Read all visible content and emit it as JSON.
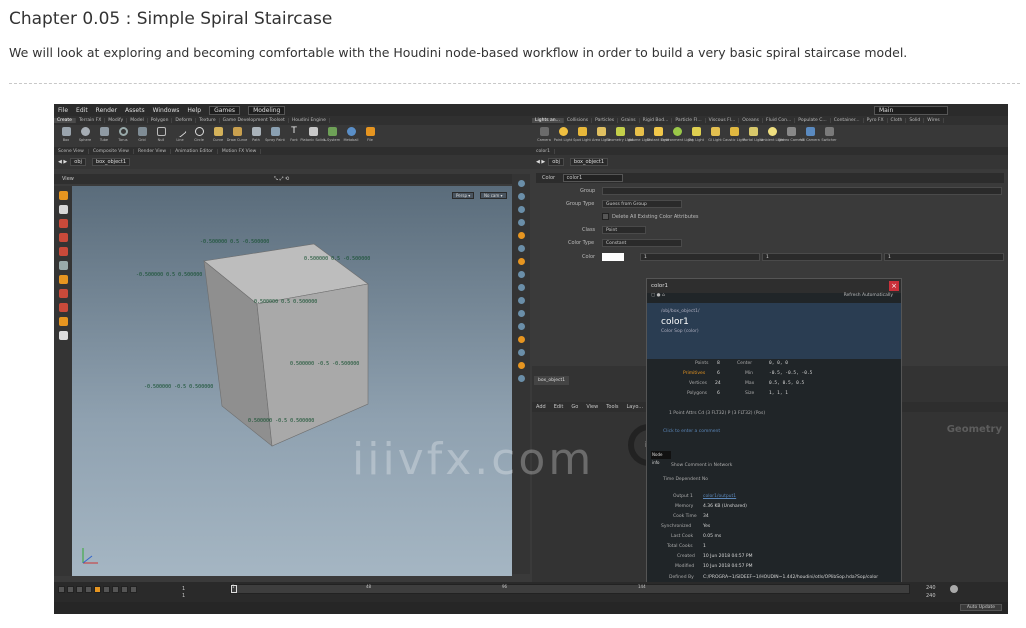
{
  "article": {
    "title": "Chapter 0.05 : Simple Spiral Staircase",
    "intro": "We will look at exploring and becoming comfortable with the Houdini node-based workflow in order to build a very basic spiral staircase model."
  },
  "houdini": {
    "menu": [
      "File",
      "Edit",
      "Render",
      "Assets",
      "Windows",
      "Help"
    ],
    "desktop": "Games",
    "desktop_right": "Modeling",
    "right_desktop": "Main",
    "shelf_tabs_left": [
      "Create",
      "Terrain FX",
      "Modify",
      "Model",
      "Polygon",
      "Deform",
      "Texture",
      "Game Development Toolset",
      "Houdini Engine"
    ],
    "shelf_tabs_right": [
      "Lights an...",
      "Collisions",
      "Particles",
      "Grains",
      "Rigid Bod...",
      "Particle FI...",
      "Viscous Fl...",
      "Oceans",
      "Fluid Con...",
      "Populate C...",
      "Container...",
      "Pyro FX",
      "Cloth",
      "Solid",
      "Wires",
      "Crowds",
      "Drive Sim"
    ],
    "tools_left": [
      "Box",
      "Sphere",
      "Tube",
      "Torus",
      "Grid",
      "Null",
      "Line",
      "Circle",
      "Curve",
      "Draw Curve",
      "Path",
      "Spray Paint",
      "Font",
      "Platonic Solids",
      "L-System",
      "Metaball",
      "File"
    ],
    "tools_right": [
      "Camera",
      "Point Light",
      "Spot Light",
      "Area Light",
      "Geometry Light",
      "Volume Light",
      "Distant Light",
      "Environment Light",
      "Sky Light",
      "GI Light",
      "Caustic Light",
      "Portal Light",
      "Ambient Light",
      "Stereo Camera",
      "VR Camera",
      "Switcher"
    ],
    "left_panel_tabs": [
      "Scene View",
      "Composite View",
      "Render View",
      "Animation Editor",
      "Motion FX View"
    ],
    "right_panel_tabs": [
      "Color",
      "color1"
    ],
    "path_left": [
      "obj",
      "box_object1"
    ],
    "path_right": [
      "obj",
      "box_object1"
    ],
    "view_label": "View",
    "persp_btn": "Persp ▾",
    "nocam_btn": "No cam ▾",
    "coords": [
      "-0.500000 0.5 -0.500000",
      "0.500000 0.5 -0.500000",
      "-0.500000 0.5 0.500000",
      "0.500000 0.5 0.500000",
      "0.500000 -0.5 -0.500000",
      "-0.500000 -0.5 0.500000",
      "0.500000 -0.5 0.500000"
    ],
    "params": {
      "group_label": "Group",
      "group_type_label": "Group Type",
      "group_type_value": "Guess from Group",
      "delete_label": "Delete All Existing Color Attributes",
      "class_label": "Class",
      "class_value": "Point",
      "color_type_label": "Color Type",
      "color_type_value": "Constant",
      "color_label": "Color",
      "color_values": [
        "1",
        "1",
        "1"
      ]
    },
    "info": {
      "title": "color1",
      "refresh": "Refresh Automatically",
      "path": "/obj/box_object1/",
      "node_name": "color1",
      "node_type": "Color Sop (color)",
      "points_label": "Points",
      "points": "8",
      "prims_label": "Primitives",
      "prims": "6",
      "vertices_label": "Vertices",
      "vertices": "24",
      "polygons_label": "Polygons",
      "polygons": "6",
      "center_label": "Center",
      "center": [
        "0,",
        "0,",
        "0"
      ],
      "min_label": "Min",
      "min": [
        "-0.5,",
        "-0.5,",
        "-0.5"
      ],
      "max_label": "Max",
      "max": [
        "0.5,",
        "0.5,",
        "0.5"
      ],
      "size_label": "Size",
      "size": [
        "1,",
        "1,",
        "1"
      ],
      "attrs": "1 Point Attrs  Cd (3 FLT32) P (3 FLT32) (Pos)",
      "comment_placeholder": "Click to enter a comment",
      "node_info": "Node info",
      "show_comment": "Show Comment in Network",
      "time_dependent": "Time Dependent  No",
      "output_label": "Output 1",
      "output": "color1/output1",
      "memory_label": "Memory",
      "memory": "4.36 KB (Unshared)",
      "cooktime_label": "Cook Time",
      "cooktime": "34",
      "sync_label": "Synchronized",
      "sync": "Yes",
      "lastcook_label": "Last Cook",
      "lastcook": "0.05 ms",
      "totalcooks_label": "Total Cooks",
      "totalcooks": "1",
      "created_label": "Created",
      "created": "10 Jun 2018 04:57 PM",
      "modified_label": "Modified",
      "modified": "10 Jun 2018 04:57 PM",
      "defined_label": "Defined By",
      "defined": "C:/PROGRA~1/SIDEEF~1/HOUDIN~1.442/houdini/otls/OPlibSop.hda?Sop/color"
    },
    "network": {
      "tab": "box_object1",
      "menu": [
        "Add",
        "Edit",
        "Go",
        "View",
        "Tools",
        "Layo..."
      ],
      "label": "Geometry"
    },
    "timeline": {
      "frame": "1",
      "frame_start": "1",
      "ticks": [
        "1",
        "24",
        "48",
        "72",
        "96",
        "120",
        "144"
      ],
      "end1": "240",
      "end2": "240",
      "right_field1": "240",
      "right_field2": "240",
      "auto_update": "Auto Update"
    },
    "watermark": "iiivfx.com",
    "accent": "#e69520"
  }
}
